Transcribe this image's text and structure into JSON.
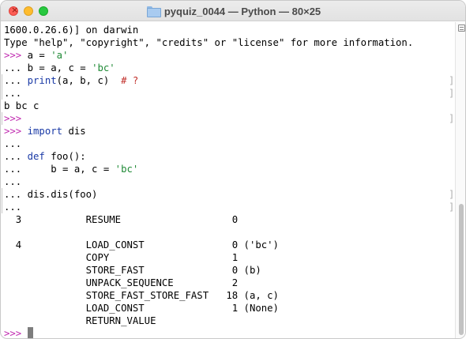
{
  "window": {
    "title": "pyquiz_0044 — Python — 80×25"
  },
  "terminal": {
    "lines": [
      {
        "segments": [
          {
            "t": "1600.0.26.6)] on darwin",
            "c": ""
          }
        ]
      },
      {
        "segments": [
          {
            "t": "Type \"help\", \"copyright\", \"credits\" or \"license\" for more information.",
            "c": ""
          }
        ]
      },
      {
        "segments": [
          {
            "t": ">>> ",
            "c": "prompt"
          },
          {
            "t": "a = ",
            "c": ""
          },
          {
            "t": "'a'",
            "c": "str"
          }
        ]
      },
      {
        "segments": [
          {
            "t": "... ",
            "c": ""
          },
          {
            "t": "b = a, c = ",
            "c": ""
          },
          {
            "t": "'bc'",
            "c": "str"
          }
        ]
      },
      {
        "segments": [
          {
            "t": "... ",
            "c": ""
          },
          {
            "t": "print",
            "c": "fn"
          },
          {
            "t": "(a, b, c)  ",
            "c": ""
          },
          {
            "t": "# ?",
            "c": "cmt"
          }
        ],
        "lmark": true,
        "rmark": true
      },
      {
        "segments": [
          {
            "t": "...",
            "c": ""
          }
        ],
        "lmark": true,
        "rmark": true
      },
      {
        "segments": [
          {
            "t": "b bc c",
            "c": ""
          }
        ]
      },
      {
        "segments": [
          {
            "t": ">>>",
            "c": "prompt"
          }
        ],
        "lmark": true,
        "rmark": true
      },
      {
        "segments": [
          {
            "t": ">>> ",
            "c": "prompt"
          },
          {
            "t": "import",
            "c": "kw"
          },
          {
            "t": " dis",
            "c": ""
          }
        ]
      },
      {
        "segments": [
          {
            "t": "...",
            "c": ""
          }
        ]
      },
      {
        "segments": [
          {
            "t": "... ",
            "c": ""
          },
          {
            "t": "def",
            "c": "kw"
          },
          {
            "t": " foo():",
            "c": ""
          }
        ]
      },
      {
        "segments": [
          {
            "t": "...     b = a, c = ",
            "c": ""
          },
          {
            "t": "'bc'",
            "c": "str"
          }
        ]
      },
      {
        "segments": [
          {
            "t": "...",
            "c": ""
          }
        ]
      },
      {
        "segments": [
          {
            "t": "... dis.dis(foo)",
            "c": ""
          }
        ],
        "lmark": true,
        "rmark": true
      },
      {
        "segments": [
          {
            "t": "...",
            "c": ""
          }
        ],
        "lmark": true,
        "rmark": true
      },
      {
        "segments": [
          {
            "t": "  3           RESUME                   0",
            "c": ""
          }
        ]
      },
      {
        "segments": [
          {
            "t": "",
            "c": ""
          }
        ]
      },
      {
        "segments": [
          {
            "t": "  4           LOAD_CONST               0 ('bc')",
            "c": ""
          }
        ]
      },
      {
        "segments": [
          {
            "t": "              COPY                     1",
            "c": ""
          }
        ]
      },
      {
        "segments": [
          {
            "t": "              STORE_FAST               0 (b)",
            "c": ""
          }
        ]
      },
      {
        "segments": [
          {
            "t": "              UNPACK_SEQUENCE          2",
            "c": ""
          }
        ]
      },
      {
        "segments": [
          {
            "t": "              STORE_FAST_STORE_FAST   18 (a, c)",
            "c": ""
          }
        ]
      },
      {
        "segments": [
          {
            "t": "              LOAD_CONST               1 (None)",
            "c": ""
          }
        ]
      },
      {
        "segments": [
          {
            "t": "              RETURN_VALUE",
            "c": ""
          }
        ]
      },
      {
        "segments": [
          {
            "t": ">>> ",
            "c": "prompt"
          }
        ],
        "cursor": true
      }
    ]
  }
}
